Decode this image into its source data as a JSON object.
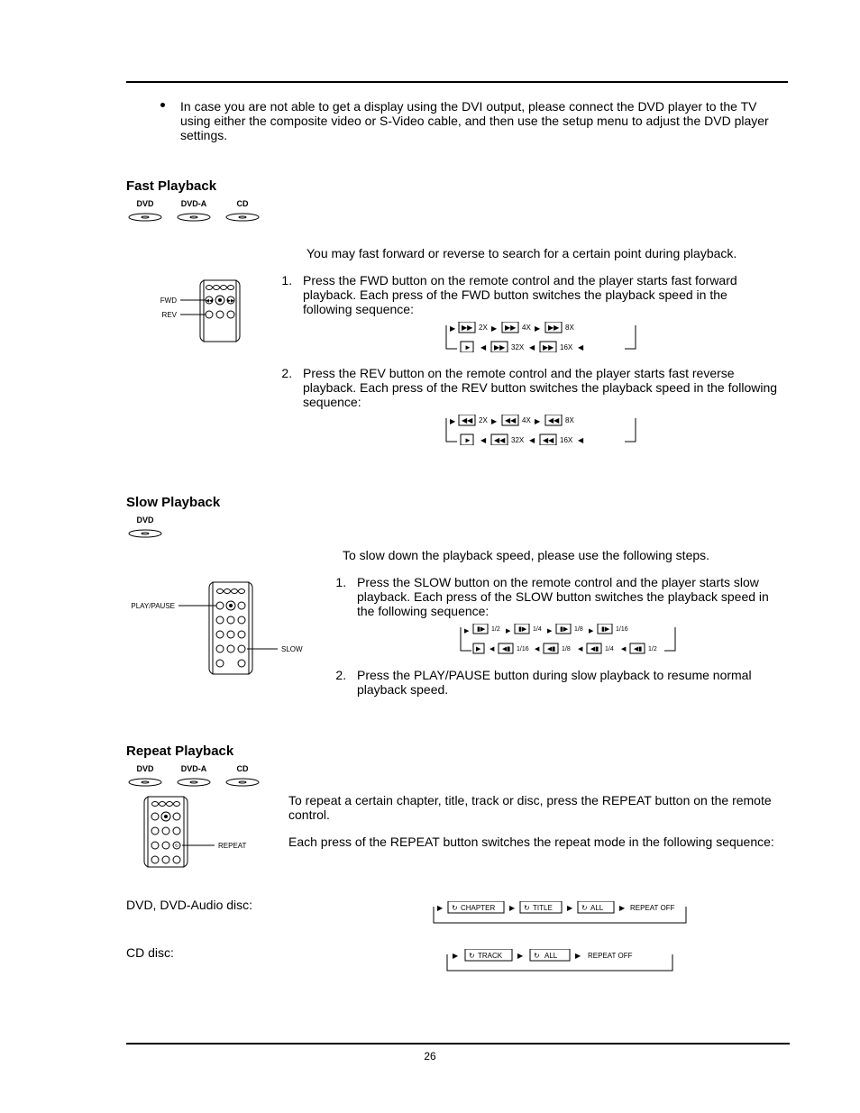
{
  "discs": {
    "dvd": "DVD",
    "dvda": "DVD-A",
    "cd": "CD"
  },
  "bullet_note": "In case you are not able to get a display using the DVI output, please connect the DVD player to the TV using either the composite video or S-Video cable, and then use the setup menu to adjust the DVD player settings.",
  "fastplay": {
    "heading": "Fast Playback",
    "intro": "You may fast forward or reverse to search for a certain point during playback.",
    "li1": "Press the FWD button on the remote control and the player starts fast forward playback.  Each press of the FWD button switches the playback speed in the following sequence:",
    "li2": "Press the REV button on the remote control and the player starts fast reverse playback.  Each press of the REV button switches the playback speed in the following sequence:",
    "fwd_labels": {
      "a": "FWD",
      "b": "REV"
    },
    "seq": {
      "x2": "2X",
      "x4": "4X",
      "x8": "8X",
      "x16": "16X",
      "x32": "32X",
      "play": "►"
    }
  },
  "slow": {
    "heading": "Slow Playback",
    "intro": "To slow down the playback speed, please use the following steps.",
    "li1": "Press the SLOW button on the remote control and the player starts slow playback.  Each press of the SLOW button switches the playback speed in the following sequence:",
    "li2": "Press the PLAY/PAUSE button during slow playback to resume normal playback speed.",
    "labels": {
      "pp": "PLAY/PAUSE",
      "slow": "SLOW"
    },
    "seq": {
      "h2": "1/2",
      "h4": "1/4",
      "h8": "1/8",
      "h16": "1/16"
    }
  },
  "repeat": {
    "heading": "Repeat Playback",
    "intro": "To repeat a certain chapter, title, track or disc, press the REPEAT button on the remote control.",
    "line2": "Each press of the REPEAT button switches the repeat mode in the following sequence:",
    "label": "REPEAT",
    "group1": "DVD, DVD-Audio disc:",
    "group2": "CD disc:",
    "seq": {
      "chapter": "CHAPTER",
      "title": "TITLE",
      "all": "ALL",
      "off": "REPEAT OFF",
      "track": "TRACK"
    }
  },
  "page_number": "26"
}
